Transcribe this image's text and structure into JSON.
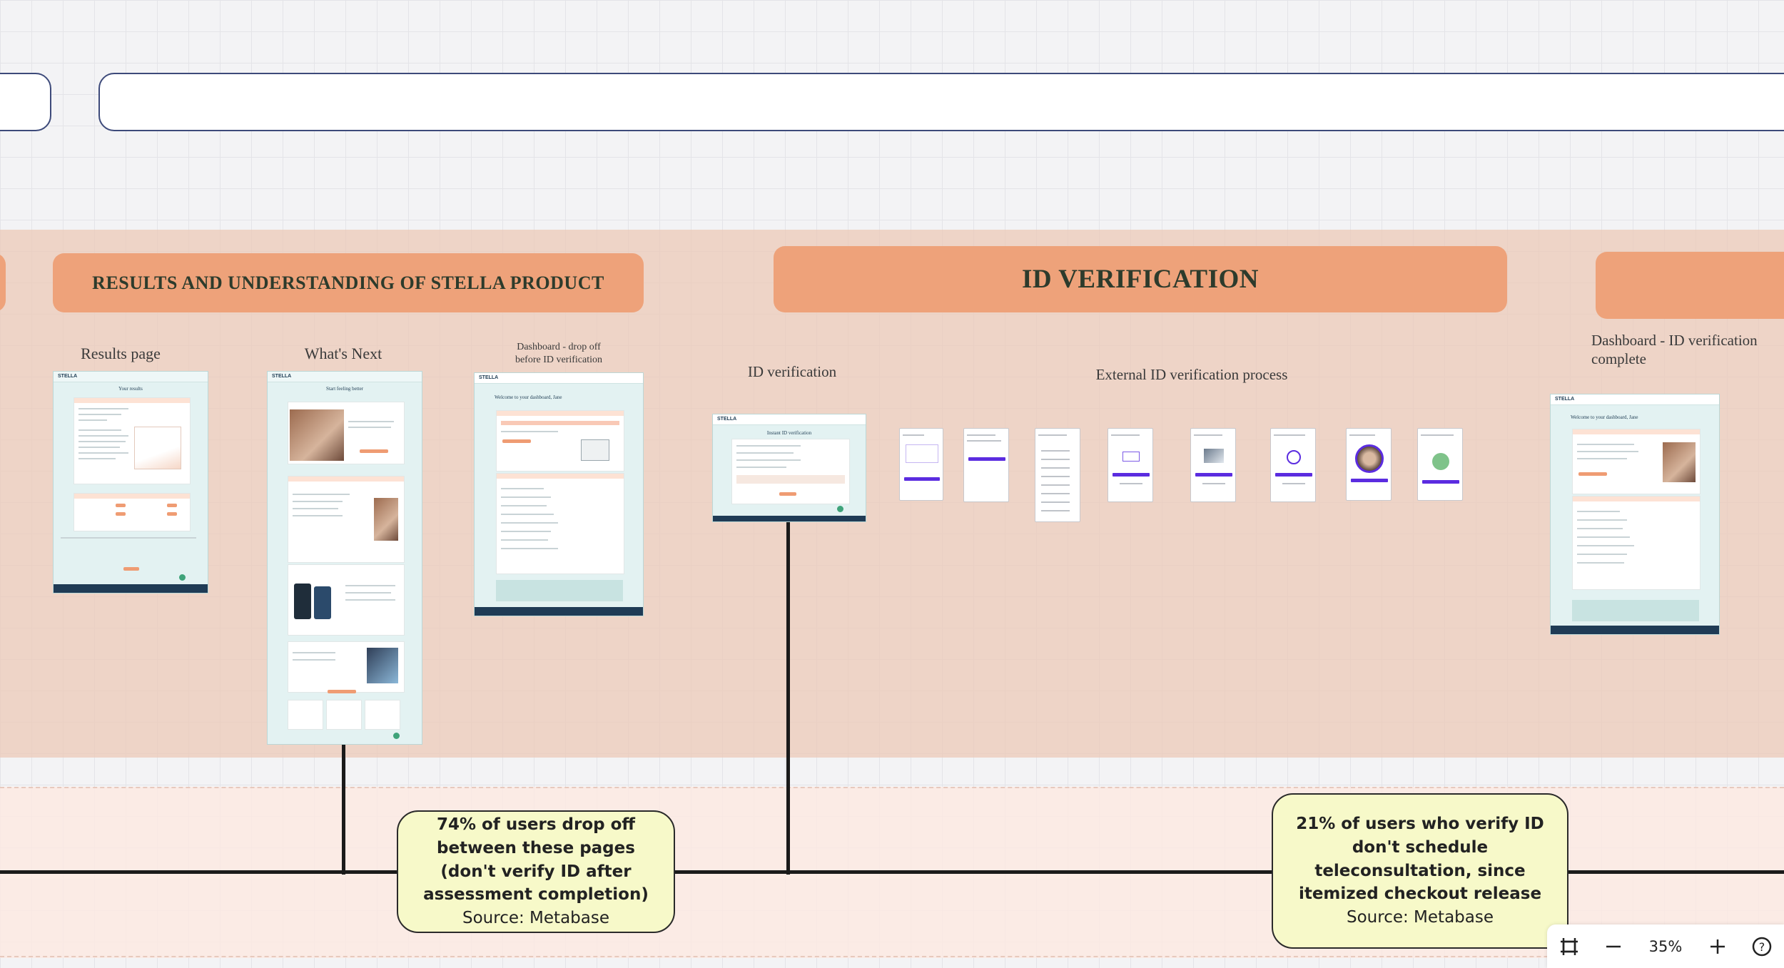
{
  "sections": {
    "results": "RESULTS AND UNDERSTANDING OF STELLA PRODUCT",
    "id_verification": "ID VERIFICATION"
  },
  "screens": {
    "results_page": "Results page",
    "whats_next": "What's Next",
    "dashboard_drop_off": "Dashboard - drop off before ID verification",
    "id_verification": "ID verification",
    "external_process": "External ID verification process",
    "dashboard_complete": "Dashboard - ID verification complete"
  },
  "mockup_text": {
    "logo": "STELLA",
    "results_heading": "Your results",
    "whats_next_heading": "Start feeling better",
    "dashboard_heading": "Welcome to your dashboard, Jane",
    "id_heading": "Instant ID verification"
  },
  "notes": {
    "drop_off": {
      "headline": "74% of users drop off between these pages (don't verify ID after assessment completion)",
      "source": "Source: Metabase"
    },
    "teleconsult": {
      "headline": "21% of users who verify ID don't schedule teleconsultation, since itemized checkout release",
      "source": "Source: Metabase"
    }
  },
  "zoom_controls": {
    "fit_icon": "fit-to-screen-icon",
    "zoom_out_icon": "minus-icon",
    "zoom_level": "35%",
    "zoom_in_icon": "plus-icon",
    "help_icon": "help-icon"
  },
  "colors": {
    "header_pill": "#eea27a",
    "lane": "#ecc8b6",
    "note": "#f7f9c9",
    "outline": "#3d4a7a",
    "phone_button": "#5b2ce0"
  }
}
